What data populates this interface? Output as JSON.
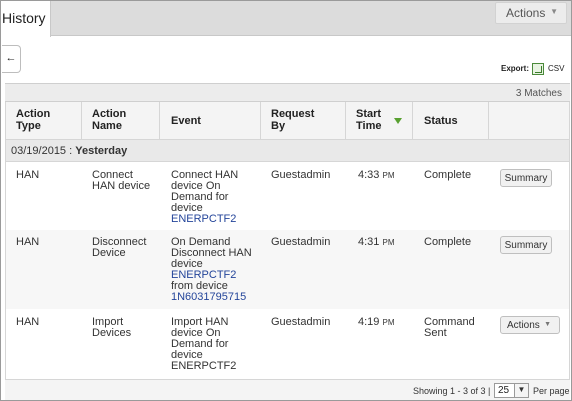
{
  "tabs": {
    "history_label": "History"
  },
  "top_actions": {
    "label": "Actions",
    "caret": "▼"
  },
  "back_button": {
    "glyph": "←"
  },
  "export": {
    "label": "Export:",
    "icon": "excel-icon",
    "csv_label": "CSV"
  },
  "matches": "3 Matches",
  "table": {
    "headers": {
      "action_type": [
        "Action",
        "Type"
      ],
      "action_name": [
        "Action",
        "Name"
      ],
      "event": "Event",
      "request_by": [
        "Request",
        "By"
      ],
      "start_time": [
        "Start",
        "Time"
      ],
      "status": "Status"
    },
    "group": {
      "date": "03/19/2015",
      "separator": " : ",
      "label": "Yesterday"
    },
    "rows": [
      {
        "action_type": "HAN",
        "action_name": [
          "Connect",
          "HAN device"
        ],
        "event": [
          "Connect HAN",
          "device On",
          "Demand for",
          "device"
        ],
        "event_link": "ENERPCTF2",
        "request_by": "Guestadmin",
        "time": "4:33",
        "ampm": "PM",
        "status": [
          "Complete"
        ],
        "button": "Summary"
      },
      {
        "action_type": "HAN",
        "action_name": [
          "Disconnect",
          "Device"
        ],
        "event": [
          "On Demand",
          "Disconnect HAN",
          "device"
        ],
        "event_link": "ENERPCTF2",
        "event_mid": "from device",
        "event_link2": "1N6031795715",
        "request_by": "Guestadmin",
        "time": "4:31",
        "ampm": "PM",
        "status": [
          "Complete"
        ],
        "button": "Summary"
      },
      {
        "action_type": "HAN",
        "action_name": [
          "Import",
          "Devices"
        ],
        "event": [
          "Import HAN",
          "device On",
          "Demand for",
          "device",
          "ENERPCTF2"
        ],
        "request_by": "Guestadmin",
        "time": "4:19",
        "ampm": "PM",
        "status": [
          "Command",
          "Sent"
        ],
        "button": "Actions",
        "button_caret": "▼"
      }
    ]
  },
  "footer": {
    "showing": "Showing 1 - 3 of 3 |",
    "page_size": "25",
    "dropdown": "▼",
    "per_page": "Per page"
  },
  "colors": {
    "link": "#24459a",
    "sort_arrow": "#58a030",
    "tab_bar": "#dcdcdc"
  }
}
